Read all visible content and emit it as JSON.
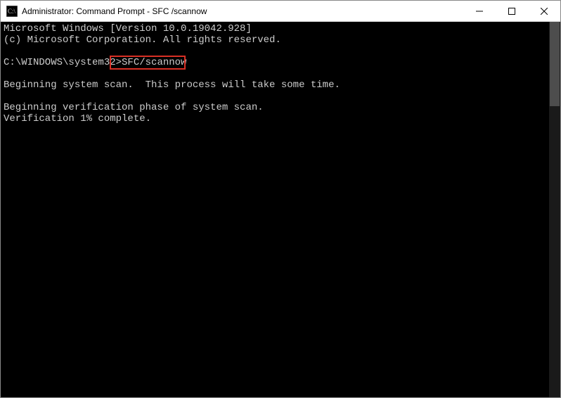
{
  "titlebar": {
    "title": "Administrator: Command Prompt - SFC /scannow"
  },
  "console": {
    "line1": "Microsoft Windows [Version 10.0.19042.928]",
    "line2": "(c) Microsoft Corporation. All rights reserved.",
    "blank1": "",
    "prompt_path": "C:\\WINDOWS\\system32>",
    "prompt_cmd": "SFC/scannow",
    "blank2": "",
    "line3": "Beginning system scan.  This process will take some time.",
    "blank3": "",
    "line4": "Beginning verification phase of system scan.",
    "line5": "Verification 1% complete."
  }
}
